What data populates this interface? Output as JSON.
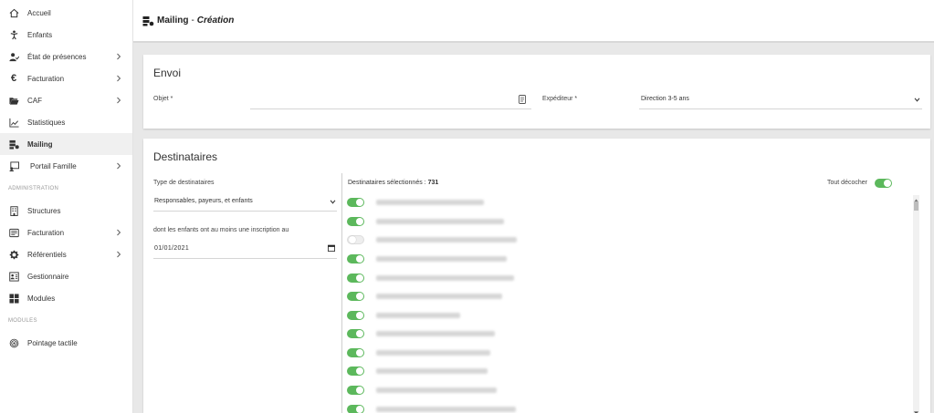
{
  "sidebar": {
    "items": [
      {
        "label": "Accueil",
        "icon": "home-icon"
      },
      {
        "label": "Enfants",
        "icon": "child-icon"
      },
      {
        "label": "État de présences",
        "icon": "user-check-icon"
      },
      {
        "label": "Facturation",
        "icon": "euro-icon"
      },
      {
        "label": "CAF",
        "icon": "folder-open-icon"
      },
      {
        "label": "Statistiques",
        "icon": "chart-icon"
      },
      {
        "label": "Mailing",
        "icon": "mailing-icon"
      },
      {
        "label": "Portail Famille",
        "icon": "portal-icon"
      }
    ],
    "admin_section": "ADMINISTRATION",
    "admin_items": [
      {
        "label": "Structures",
        "icon": "building-icon"
      },
      {
        "label": "Facturation",
        "icon": "invoice-icon"
      },
      {
        "label": "Référentiels",
        "icon": "gear-icon"
      },
      {
        "label": "Gestionnaire",
        "icon": "manager-icon"
      },
      {
        "label": "Modules",
        "icon": "modules-icon"
      }
    ],
    "modules_section": "MODULES",
    "module_items": [
      {
        "label": "Pointage tactile",
        "icon": "touch-icon"
      }
    ]
  },
  "header": {
    "title": "Mailing",
    "separator": "-",
    "subtitle": "Création"
  },
  "envoi": {
    "title": "Envoi",
    "objet_label": "Objet *",
    "objet_value": "",
    "expediteur_label": "Expéditeur *",
    "expediteur_value": "Direction 3-5 ans"
  },
  "destinataires": {
    "title": "Destinataires",
    "type_label": "Type de destinataires",
    "type_value": "Responsables, payeurs, et enfants",
    "inscription_label": "dont les enfants ont au moins une inscription au",
    "date_value": "01/01/2021",
    "selected_label": "Destinataires sélectionnés :",
    "selected_count": "731",
    "uncheck_all_label": "Tout décocher",
    "recipients": [
      {
        "checked": true
      },
      {
        "checked": true
      },
      {
        "checked": false
      },
      {
        "checked": true
      },
      {
        "checked": true
      },
      {
        "checked": true
      },
      {
        "checked": true
      },
      {
        "checked": true
      },
      {
        "checked": true
      },
      {
        "checked": true
      },
      {
        "checked": true
      },
      {
        "checked": true
      }
    ]
  },
  "colors": {
    "toggle_on": "#5cb85c",
    "toggle_off": "#eeeeee"
  }
}
